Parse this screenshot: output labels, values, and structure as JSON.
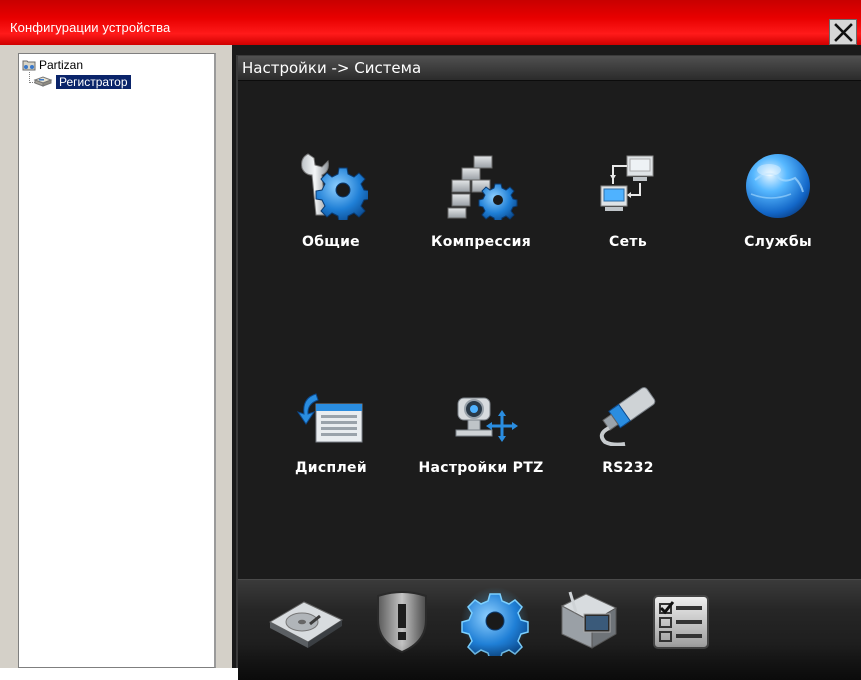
{
  "window": {
    "title": "Конфигурации устройства",
    "close_glyph": "✕"
  },
  "tree": {
    "root_label": "Partizan",
    "root_icon": "network-folder-icon",
    "child_label": "Регистратор",
    "child_icon": "dvr-device-icon"
  },
  "main": {
    "breadcrumb": "Настройки -> Система",
    "tiles": [
      {
        "label": "Общие",
        "icon": "wrench-gear-icon"
      },
      {
        "label": "Компрессия",
        "icon": "compression-bricks-icon"
      },
      {
        "label": "Сеть",
        "icon": "network-computers-icon"
      },
      {
        "label": "Службы",
        "icon": "globe-icon"
      },
      {
        "label": "Дисплей",
        "icon": "display-list-icon"
      },
      {
        "label": "Настройки PTZ",
        "icon": "ptz-camera-icon"
      },
      {
        "label": "RS232",
        "icon": "rs232-cable-icon"
      }
    ],
    "dock": [
      {
        "icon": "hard-disk-icon"
      },
      {
        "icon": "alarm-shield-icon"
      },
      {
        "icon": "system-gear-icon",
        "active": true
      },
      {
        "icon": "tools-monitor-icon"
      },
      {
        "icon": "checklist-icon"
      }
    ]
  },
  "colors": {
    "titlebar": "#e80000",
    "panel_bg": "#1c1c1c",
    "tree_selection": "#0a246a",
    "accent_blue": "#2a8de0"
  }
}
